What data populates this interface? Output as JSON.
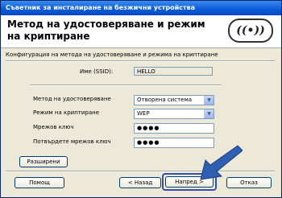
{
  "window": {
    "title": "Съветник за инсталиране на безжични устройства"
  },
  "banner": {
    "title": "Метод на удостоверяване и режим на криптиране",
    "logo_text": "((•))"
  },
  "subtitle": "Конфигурация на метода на удостоверяване и режима на криптиране",
  "ssid": {
    "label": "Име (SSID):",
    "value": "HELLO"
  },
  "auth": {
    "label": "Метод на удостоверяване",
    "value": "Отворена система"
  },
  "encryption": {
    "label": "Режим на криптиране",
    "value": "WEP"
  },
  "network_key": {
    "label": "Мрежов ключ",
    "value": "●●●●"
  },
  "confirm_key": {
    "label": "Потвърдете мрежов ключ",
    "value": "●●●●"
  },
  "buttons": {
    "advanced": "Разширени",
    "help": "Помощ",
    "back": "< Назад",
    "next": "Напред >",
    "cancel": "Отказ"
  },
  "icons": {
    "dropdown": "chevron-down-icon",
    "pointer": "blue-arrow-icon",
    "logo": "wireless-logo-icon"
  },
  "colors": {
    "titlebar": "#0a5ad6",
    "arrow": "#2f5fb0"
  }
}
